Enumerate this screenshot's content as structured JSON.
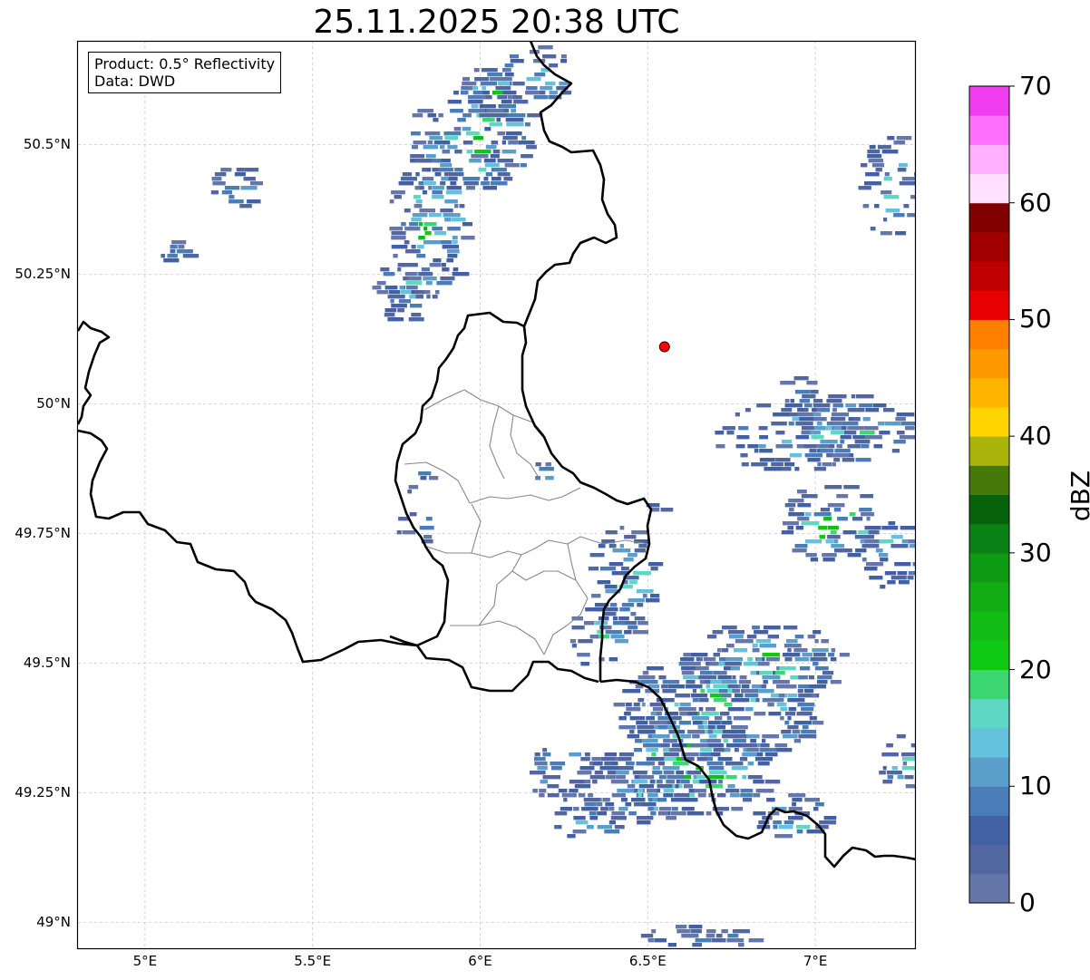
{
  "title": "25.11.2025 20:38 UTC",
  "info_box": {
    "line1": "Product: 0.5° Reflectivity",
    "line2": "Data: DWD"
  },
  "map": {
    "lon_range": [
      4.8,
      7.3
    ],
    "lat_range": [
      48.95,
      50.7
    ],
    "gridlines": true,
    "lat_ticks": [
      {
        "value": 50.5,
        "label": "50.5°N"
      },
      {
        "value": 50.25,
        "label": "50.25°N"
      },
      {
        "value": 50.0,
        "label": "50°N"
      },
      {
        "value": 49.75,
        "label": "49.75°N"
      },
      {
        "value": 49.5,
        "label": "49.5°N"
      },
      {
        "value": 49.25,
        "label": "49.25°N"
      },
      {
        "value": 49.0,
        "label": "49°N"
      }
    ],
    "lon_ticks": [
      {
        "value": 5.0,
        "label": "5°E"
      },
      {
        "value": 5.5,
        "label": "5.5°E"
      },
      {
        "value": 6.0,
        "label": "6°E"
      },
      {
        "value": 6.5,
        "label": "6.5°E"
      },
      {
        "value": 7.0,
        "label": "7°E"
      }
    ],
    "radar_site": {
      "lon": 6.55,
      "lat": 50.11,
      "color": "#ff0000"
    }
  },
  "colorbar": {
    "unit": "dBZ",
    "min": 0,
    "max": 70,
    "step": 2.5,
    "tick_labels": [
      "0",
      "10",
      "20",
      "30",
      "40",
      "50",
      "60",
      "70"
    ],
    "colors": [
      "#6477a8",
      "#52679f",
      "#4260a4",
      "#4a7db7",
      "#5a9ecb",
      "#64c2dc",
      "#5ed8c4",
      "#3cd673",
      "#10c914",
      "#14bd16",
      "#12ad14",
      "#0e9a12",
      "#0b8014",
      "#07620c",
      "#46780a",
      "#aab40a",
      "#ffd500",
      "#ffb400",
      "#ff9900",
      "#ff7f00",
      "#e60000",
      "#c00000",
      "#a00000",
      "#800000",
      "#ffe0ff",
      "#ffb0ff",
      "#ff70ff",
      "#ee3cee"
    ]
  }
}
